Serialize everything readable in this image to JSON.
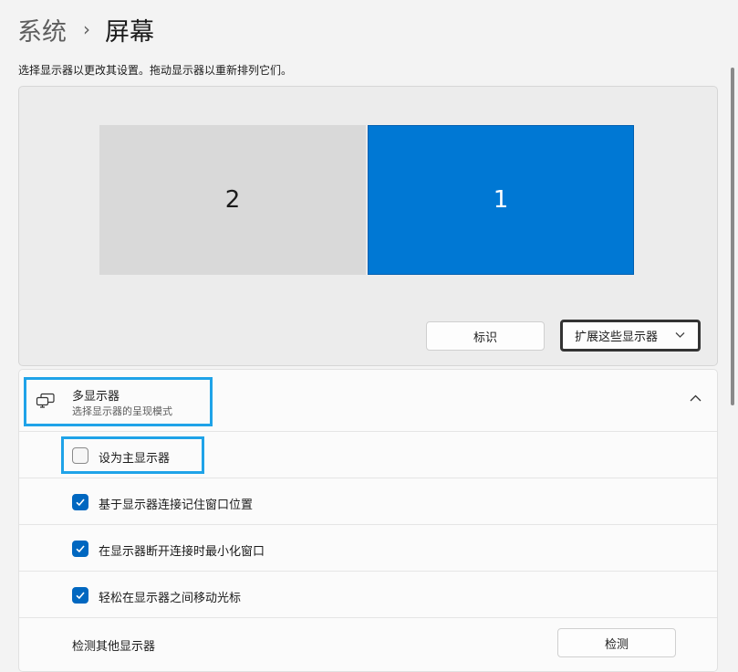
{
  "breadcrumb": {
    "parent": "系统",
    "separator": "›",
    "current": "屏幕"
  },
  "description": "选择显示器以更改其设置。拖动显示器以重新排列它们。",
  "monitors": [
    {
      "label": "2",
      "selected": false
    },
    {
      "label": "1",
      "selected": true
    }
  ],
  "buttons": {
    "identify": "标识",
    "display_mode": "扩展这些显示器",
    "detect": "检测"
  },
  "multi_display": {
    "title": "多显示器",
    "subtitle": "选择显示器的呈现模式",
    "expanded": true
  },
  "options": [
    {
      "label": "设为主显示器",
      "checked": false
    },
    {
      "label": "基于显示器连接记住窗口位置",
      "checked": true
    },
    {
      "label": "在显示器断开连接时最小化窗口",
      "checked": true
    },
    {
      "label": "轻松在显示器之间移动光标",
      "checked": true
    }
  ],
  "detect_row": {
    "label": "检测其他显示器"
  },
  "colors": {
    "accent": "#0078d4",
    "checkbox": "#0067c0",
    "highlight": "#1fa3e8"
  },
  "icons": {
    "multi_display": "multi-display-icon",
    "collapse": "chevron-up-icon",
    "dropdown": "chevron-down-icon",
    "check": "check-icon"
  }
}
